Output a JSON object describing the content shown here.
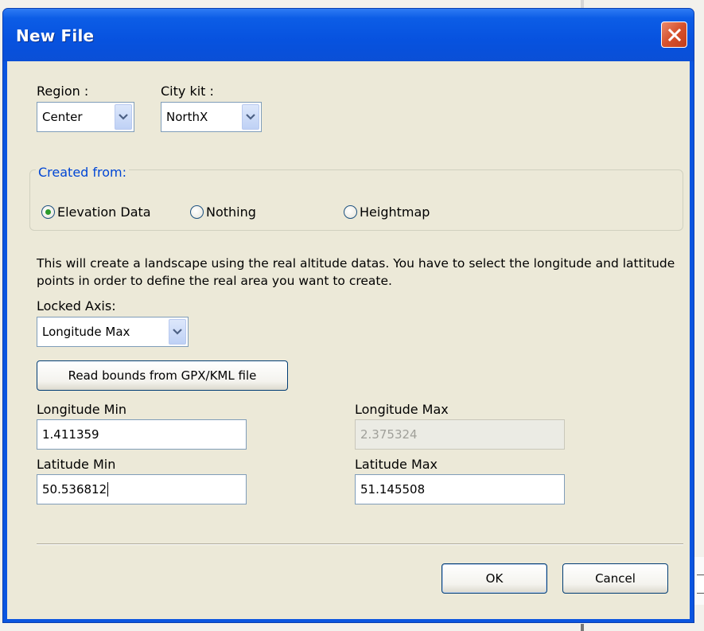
{
  "dialog": {
    "title": "New File"
  },
  "region": {
    "label": "Region :",
    "value": "Center"
  },
  "city_kit": {
    "label": "City kit :",
    "value": "NorthX"
  },
  "created_from": {
    "legend": "Created from:",
    "options": [
      {
        "label": "Elevation Data",
        "selected": true
      },
      {
        "label": "Nothing",
        "selected": false
      },
      {
        "label": "Heightmap",
        "selected": false
      }
    ]
  },
  "description": "This will create a landscape using the real altitude datas. You have to select the longitude and lattitude points in order to define the real area you want to create.",
  "locked_axis": {
    "label": "Locked Axis:",
    "value": "Longitude Max"
  },
  "read_bounds_label": "Read bounds from GPX/KML file",
  "fields": {
    "longitude_min": {
      "label": "Longitude Min",
      "value": "1.411359"
    },
    "longitude_max": {
      "label": "Longitude Max",
      "value": "2.375324",
      "disabled": true
    },
    "latitude_min": {
      "label": "Latitude Min",
      "value": "50.536812"
    },
    "latitude_max": {
      "label": "Latitude Max",
      "value": "51.145508"
    }
  },
  "buttons": {
    "ok": "OK",
    "cancel": "Cancel"
  },
  "colors": {
    "titlebar": "#0752df",
    "client_bg": "#ece9d8",
    "group_legend": "#0046d5",
    "close_button": "#d6512c"
  }
}
